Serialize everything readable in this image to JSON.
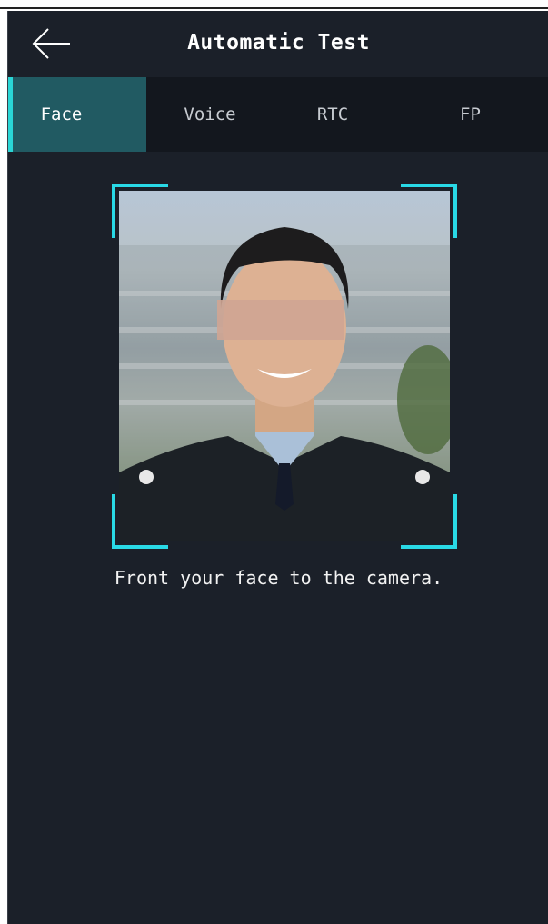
{
  "header": {
    "title": "Automatic Test",
    "back_icon": "arrow-left-icon"
  },
  "tabs": [
    {
      "label": "Face",
      "active": true
    },
    {
      "label": "Voice",
      "active": false
    },
    {
      "label": "RTC",
      "active": false
    },
    {
      "label": "FP",
      "active": false
    }
  ],
  "face_test": {
    "hint": "Front your face to the camera."
  },
  "colors": {
    "background": "#1b2029",
    "tab_bar": "#13171e",
    "active_tab": "#215a62",
    "accent": "#29d9e6",
    "text": "#ffffff"
  }
}
